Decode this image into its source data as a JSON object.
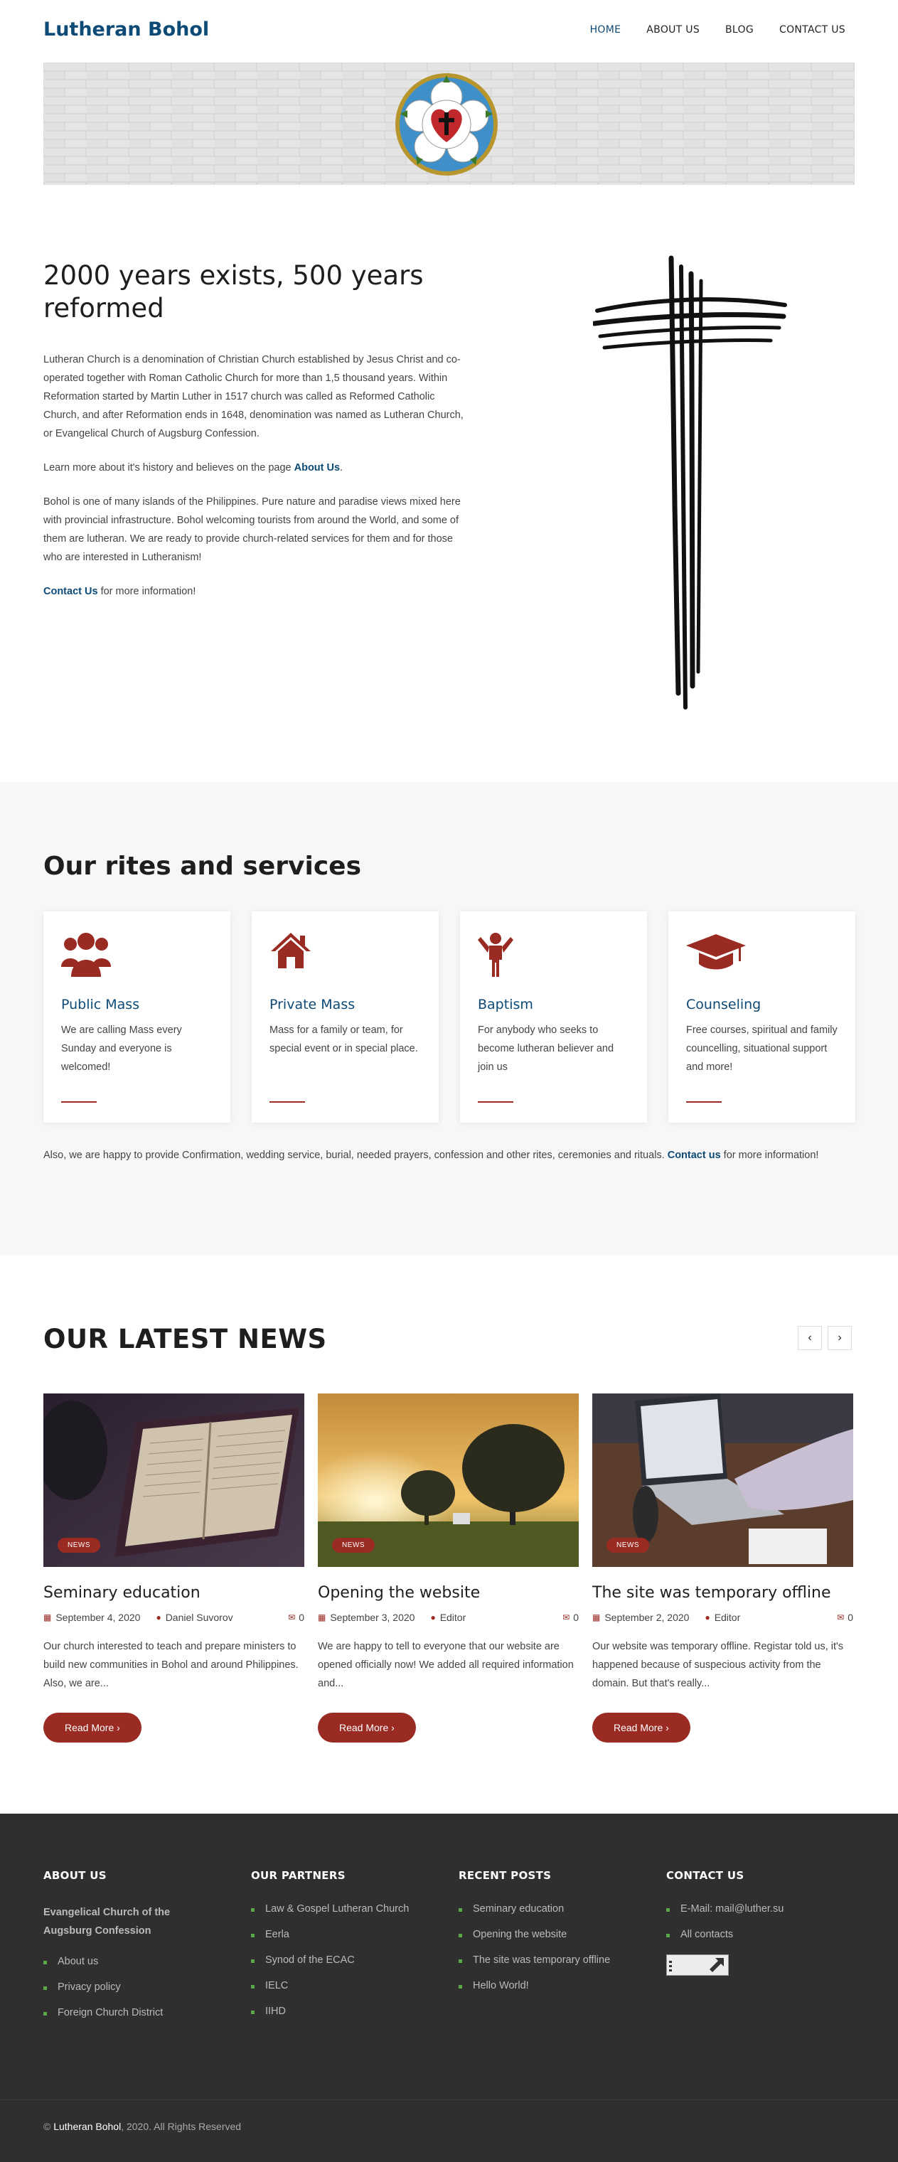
{
  "header": {
    "logo": "Lutheran Bohol",
    "nav": [
      {
        "label": "HOME",
        "active": true
      },
      {
        "label": "ABOUT US",
        "active": false
      },
      {
        "label": "BLOG",
        "active": false
      },
      {
        "label": "CONTACT US",
        "active": false
      }
    ]
  },
  "intro": {
    "title": "2000 years exists, 500 years reformed",
    "p1": "Lutheran Church is a denomination of Christian Church established by Jesus Christ and co-operated together with Roman Catholic Church for more than 1,5 thousand years. Within Reformation started by Martin Luther in 1517 church was called as Reformed Catholic Church, and after Reformation ends in 1648, denomination was named as Lutheran Church, or Evangelical Church of Augsburg Confession.",
    "p2_before": "Learn more about it's history and believes on the page ",
    "p2_link": "About Us",
    "p2_after": ".",
    "p3": "Bohol is one of many islands of the Philippines. Pure nature and paradise views mixed here with provincial infrastructure. Bohol welcoming tourists from around the World, and some of them are lutheran. We are ready to provide church-related services for them and for those who are interested in Lutheranism!",
    "p4_link": "Contact Us",
    "p4_after": " for more information!"
  },
  "services": {
    "title": "Our rites and services",
    "cards": [
      {
        "icon": "users-icon",
        "title": "Public Mass",
        "text": "We are calling Mass every Sunday and everyone is welcomed!"
      },
      {
        "icon": "home-icon",
        "title": "Private Mass",
        "text": "Mass for a family or team, for special event or in special place."
      },
      {
        "icon": "child-icon",
        "title": "Baptism",
        "text": "For anybody who seeks to become lutheran believer and join us"
      },
      {
        "icon": "graduation-cap-icon",
        "title": "Counseling",
        "text": "Free courses, spiritual and family councelling, situational support and more!"
      }
    ],
    "note_before": "Also, we are happy to provide Confirmation, wedding service, burial, needed prayers, confession and other rites, ceremonies and rituals. ",
    "note_link": "Contact us",
    "note_after": " for more information!"
  },
  "news": {
    "title": "OUR LATEST NEWS",
    "prev": "‹",
    "next": "›",
    "posts": [
      {
        "tag": "NEWS",
        "title": "Seminary education",
        "date": "September 4, 2020",
        "author": "Daniel Suvorov",
        "comments": "0",
        "excerpt": "Our church interested to teach and prepare ministers to build new communities in Bohol and around Philippines. Also, we are...",
        "button": "Read More ›"
      },
      {
        "tag": "NEWS",
        "title": "Opening the website",
        "date": "September 3, 2020",
        "author": "Editor",
        "comments": "0",
        "excerpt": "We are happy to tell to everyone that our website are opened officially now! We added all required information and...",
        "button": "Read More ›"
      },
      {
        "tag": "NEWS",
        "title": "The site was temporary offline",
        "date": "September 2, 2020",
        "author": "Editor",
        "comments": "0",
        "excerpt": "Our website was temporary offline. Registar told us, it's happened because of suspecious activity from the domain. But that's really...",
        "button": "Read More ›"
      }
    ]
  },
  "footer": {
    "about": {
      "title": "ABOUT US",
      "org": "Evangelical Church of the Augsburg Confession",
      "links": [
        "About us",
        "Privacy policy",
        "Foreign Church District"
      ]
    },
    "partners": {
      "title": "OUR PARTNERS",
      "links": [
        "Law & Gospel Lutheran Church",
        "Eerla",
        "Synod of the ECAC",
        "IELC",
        "IIHD"
      ]
    },
    "recent": {
      "title": "RECENT POSTS",
      "links": [
        "Seminary education",
        "Opening the website",
        "The site was temporary offline",
        "Hello World!"
      ]
    },
    "contact": {
      "title": "CONTACT US",
      "links": [
        "E-Mail: mail@luther.su",
        "All contacts"
      ]
    },
    "copyright_brand": "Lutheran Bohol",
    "copyright_rest": ", 2020. All Rights Reserved"
  },
  "colors": {
    "brand": "#0d4a76",
    "accent": "#9a2b23",
    "footer_bg": "#2f2f2f",
    "bullet": "#5ca64a"
  }
}
